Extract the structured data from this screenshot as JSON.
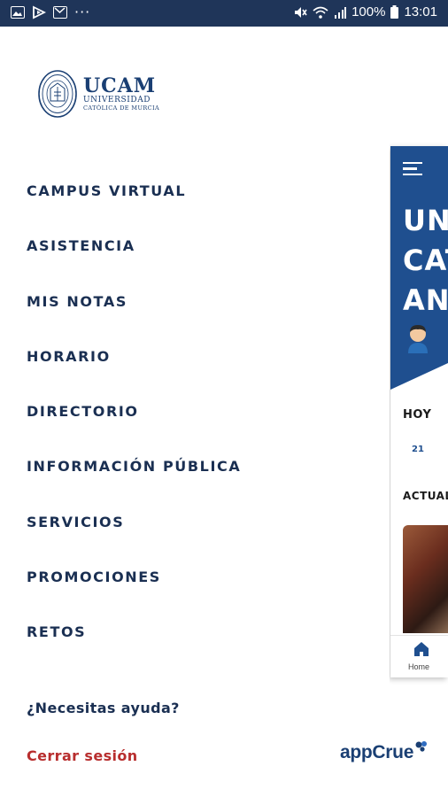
{
  "status_bar": {
    "battery": "100%",
    "time": "13:01",
    "left_icons": [
      "image-icon",
      "play-store-icon",
      "mail-icon",
      "more-dots-icon"
    ],
    "right_icons": [
      "mute-icon",
      "wifi-icon",
      "signal-icon",
      "battery-icon"
    ]
  },
  "drawer": {
    "logo": {
      "name": "UCAM",
      "line1": "UNIVERSIDAD",
      "line2": "CATÓLICA DE MURCIA"
    },
    "menu": [
      {
        "label": "CAMPUS VIRTUAL"
      },
      {
        "label": "ASISTENCIA"
      },
      {
        "label": "MIS NOTAS"
      },
      {
        "label": "HORARIO"
      },
      {
        "label": "DIRECTORIO"
      },
      {
        "label": "INFORMACIÓN PÚBLICA"
      },
      {
        "label": "SERVICIOS"
      },
      {
        "label": "PROMOCIONES"
      },
      {
        "label": "RETOS"
      }
    ],
    "help_label": "¿Necesitas ayuda?",
    "logout_label": "Cerrar sesión",
    "brand": "appCrue"
  },
  "background_app": {
    "title_fragment": "UN\nCAT\nAN",
    "today_label": "HOY",
    "day": "21",
    "news_label": "ACTUAL",
    "tab_home": "Home"
  },
  "colors": {
    "status_bar": "#1f3559",
    "primary": "#1f4f8f",
    "menu_text": "#1a2f52",
    "logout": "#b82e2e"
  }
}
